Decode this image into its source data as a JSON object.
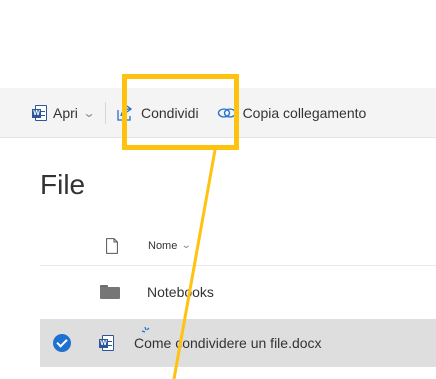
{
  "toolbar": {
    "open_label": "Apri",
    "share_label": "Condividi",
    "copy_link_label": "Copia collegamento"
  },
  "page": {
    "title": "File"
  },
  "list": {
    "column_name": "Nome",
    "items": [
      {
        "name": "Notebooks",
        "type": "folder",
        "selected": false
      },
      {
        "name": "Come condividere un file.docx",
        "type": "word-document",
        "selected": true
      }
    ]
  },
  "colors": {
    "highlight": "#ffc20e",
    "accent_blue": "#1f71d0",
    "word_blue": "#2b579a",
    "toolbar_bg": "#f4f4f4",
    "selected_row_bg": "#dedede"
  },
  "icons": {
    "open": "word-icon",
    "share": "share-icon",
    "copy_link": "link-icon",
    "file_type_header": "document-icon",
    "folder": "folder-icon",
    "selected": "checkmark-icon"
  }
}
